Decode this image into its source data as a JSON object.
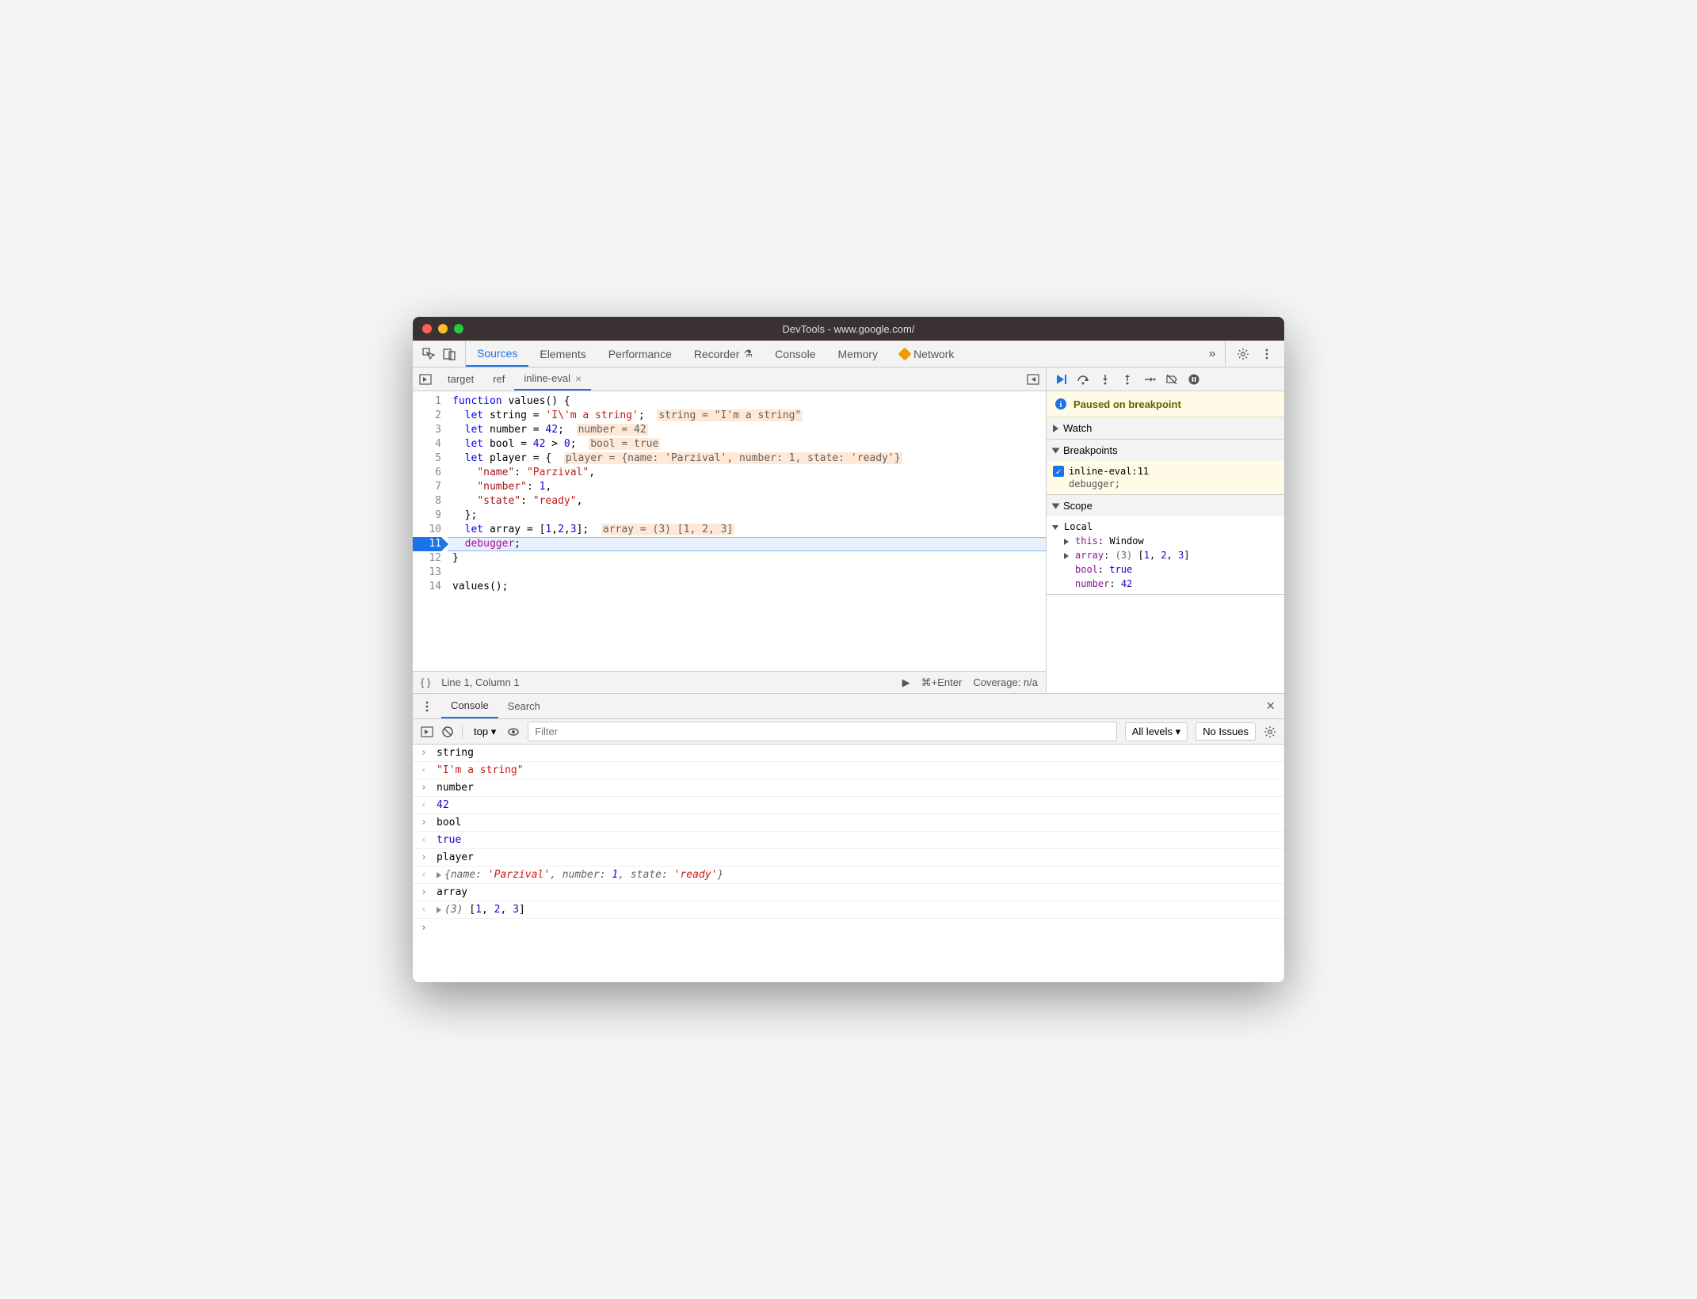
{
  "window": {
    "title": "DevTools - www.google.com/"
  },
  "mainTabs": {
    "items": [
      "Sources",
      "Elements",
      "Performance",
      "Recorder",
      "Console",
      "Memory",
      "Network"
    ],
    "recorderHasBeaker": true,
    "networkHasWarning": true,
    "active": 0
  },
  "fileTabs": {
    "items": [
      "target",
      "ref",
      "inline-eval"
    ],
    "active": 2
  },
  "editor": {
    "breakpointLine": 11,
    "lines": [
      {
        "n": 1,
        "html": "<span class='k-decl'>function</span> values() {"
      },
      {
        "n": 2,
        "html": "  <span class='k-decl'>let</span> string = <span class='k-str'>'I\\'m a string'</span>;  <span class='inline-eval'>string = \"I'm a string\"</span>"
      },
      {
        "n": 3,
        "html": "  <span class='k-decl'>let</span> number = <span class='k-num'>42</span>;  <span class='inline-eval'>number = 42</span>"
      },
      {
        "n": 4,
        "html": "  <span class='k-decl'>let</span> bool = <span class='k-num'>42</span> &gt; <span class='k-num'>0</span>;  <span class='inline-eval'>bool = true</span>"
      },
      {
        "n": 5,
        "html": "  <span class='k-decl'>let</span> player = {  <span class='inline-eval'>player = {name: 'Parzival', number: 1, state: 'ready'}</span>"
      },
      {
        "n": 6,
        "html": "    <span class='k-prop'>\"name\"</span>: <span class='k-str'>\"Parzival\"</span>,"
      },
      {
        "n": 7,
        "html": "    <span class='k-prop'>\"number\"</span>: <span class='k-num'>1</span>,"
      },
      {
        "n": 8,
        "html": "    <span class='k-prop'>\"state\"</span>: <span class='k-str'>\"ready\"</span>,"
      },
      {
        "n": 9,
        "html": "  };"
      },
      {
        "n": 10,
        "html": "  <span class='k-decl'>let</span> array = [<span class='k-num'>1</span>,<span class='k-num'>2</span>,<span class='k-num'>3</span>];  <span class='inline-eval'>array = (3) [1, 2, 3]</span>"
      },
      {
        "n": 11,
        "html": "  <span class='k-dbg'>debugger</span>;",
        "hl": true
      },
      {
        "n": 12,
        "html": "}"
      },
      {
        "n": 13,
        "html": ""
      },
      {
        "n": 14,
        "html": "values();"
      }
    ]
  },
  "statusBar": {
    "position": "Line 1, Column 1",
    "shortcut": "⌘+Enter",
    "coverage": "Coverage: n/a"
  },
  "debugger": {
    "pausedText": "Paused on breakpoint",
    "sections": {
      "watch": "Watch",
      "breakpoints": "Breakpoints",
      "scope": "Scope"
    },
    "breakpoint": {
      "label": "inline-eval:11",
      "code": "debugger;"
    },
    "scope": {
      "local": "Local",
      "rows": [
        {
          "expand": "tri",
          "name": "this",
          "colon": ": ",
          "val": "Window",
          "cls": ""
        },
        {
          "expand": "tri",
          "name": "array",
          "colon": ": ",
          "val": "(3) ",
          "extra": "[<span class='vval-num'>1</span>, <span class='vval-num'>2</span>, <span class='vval-num'>3</span>]"
        },
        {
          "expand": "",
          "name": "bool",
          "colon": ": ",
          "val": "true",
          "cls": "vval-bool"
        },
        {
          "expand": "",
          "name": "number",
          "colon": ": ",
          "val": "42",
          "cls": "vval-num"
        }
      ]
    }
  },
  "drawer": {
    "tabs": [
      "Console",
      "Search"
    ],
    "active": 0,
    "toolbar": {
      "context": "top",
      "filterPlaceholder": "Filter",
      "levels": "All levels",
      "issues": "No Issues"
    },
    "lines": [
      {
        "type": "in",
        "text": "string"
      },
      {
        "type": "out",
        "html": "<span class='cstr'>\"I'm a string\"</span>"
      },
      {
        "type": "in",
        "text": "number"
      },
      {
        "type": "out",
        "html": "<span class='cnum'>42</span>"
      },
      {
        "type": "in",
        "text": "bool"
      },
      {
        "type": "out",
        "html": "<span class='cbool'>true</span>"
      },
      {
        "type": "in",
        "text": "player"
      },
      {
        "type": "out",
        "html": "<span class='expand-tri'></span><span class='cobj'>{<span class='key'>name</span>: <span class='sv'>'Parzival'</span>, <span class='key'>number</span>: <span class='nv'>1</span>, <span class='key'>state</span>: <span class='sv'>'ready'</span>}</span>"
      },
      {
        "type": "in",
        "text": "array"
      },
      {
        "type": "out",
        "html": "<span class='expand-tri'></span><span class='cobj'>(3)</span> [<span class='cnum'>1</span>, <span class='cnum'>2</span>, <span class='cnum'>3</span>]"
      }
    ]
  }
}
